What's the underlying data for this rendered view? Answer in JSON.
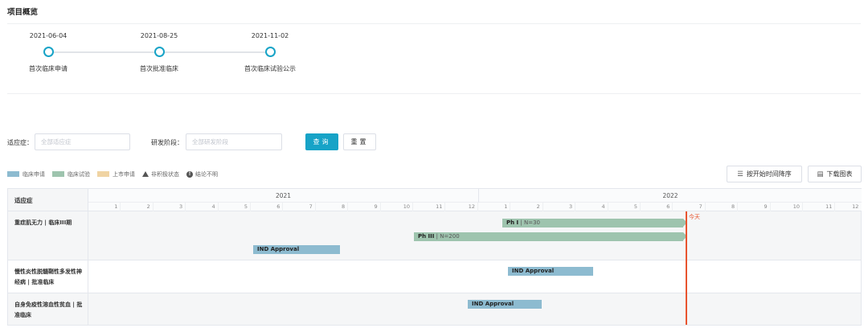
{
  "overview": {
    "title": "项目概览",
    "milestones": [
      {
        "date": "2021-06-04",
        "label": "首次临床申请"
      },
      {
        "date": "2021-08-25",
        "label": "首次批准临床"
      },
      {
        "date": "2021-11-02",
        "label": "首次临床试验公示"
      }
    ]
  },
  "filters": {
    "indication_label": "适应症：",
    "indication_placeholder": "全部适应症",
    "stage_label": "研发阶段：",
    "stage_placeholder": "全部研发阶段",
    "query_button": "查询",
    "reset_button": "重置"
  },
  "legend": {
    "items": [
      {
        "label": "临床申请",
        "color": "#8dbbd0"
      },
      {
        "label": "临床试验",
        "color": "#9ec4ae"
      },
      {
        "label": "上市申请",
        "color": "#f0d4a3"
      }
    ],
    "inactive_label": "非积极状态",
    "unknown_label": "结论不明",
    "unknown_glyph": "!"
  },
  "toolbar": {
    "sort_label": "按开始时间降序",
    "sort_icon": "sort-list-icon",
    "download_label": "下载图表",
    "download_icon": "download-chart-icon"
  },
  "gantt": {
    "column_header": "适应症",
    "years": [
      "2021",
      "2022"
    ],
    "months": [
      "1",
      "2",
      "3",
      "4",
      "5",
      "6",
      "7",
      "8",
      "9",
      "10",
      "11",
      "12"
    ],
    "today_label": "今天",
    "rows": [
      {
        "label": "重症肌无力 | 临床III期",
        "bars": [
          {
            "type": "trial",
            "name": "Ph I",
            "detail": "N=30"
          },
          {
            "type": "trial",
            "name": "Ph III",
            "detail": "N=200"
          },
          {
            "type": "application",
            "name": "IND Approval",
            "detail": ""
          }
        ]
      },
      {
        "label": "慢性炎性脱髓鞘性多发性神经病 | 批准临床",
        "bars": [
          {
            "type": "application",
            "name": "IND Approval",
            "detail": ""
          }
        ]
      },
      {
        "label": "自身免疫性溶血性贫血 | 批准临床",
        "bars": [
          {
            "type": "application",
            "name": "IND Approval",
            "detail": ""
          }
        ]
      }
    ]
  },
  "colors": {
    "accent": "#17a3c7",
    "application": "#8dbbd0",
    "trial": "#9ec4ae",
    "marketing": "#f0d4a3",
    "today": "#e8542f"
  }
}
